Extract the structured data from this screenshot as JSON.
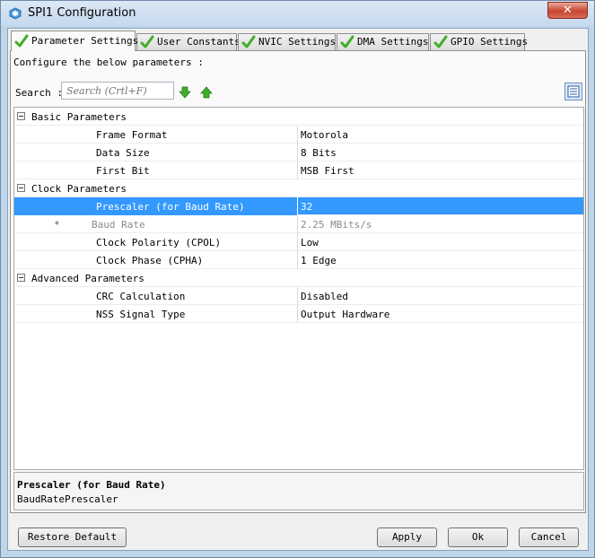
{
  "window": {
    "title": "SPI1 Configuration",
    "close_label": "✕",
    "icons": {
      "title": "gear-cube-icon",
      "close": "close-icon"
    }
  },
  "tabs": [
    {
      "label": "Parameter Settings",
      "active": true,
      "icon": "checkmark-icon"
    },
    {
      "label": "User Constants",
      "active": false,
      "icon": "checkmark-icon"
    },
    {
      "label": "NVIC Settings",
      "active": false,
      "icon": "checkmark-icon"
    },
    {
      "label": "DMA Settings",
      "active": false,
      "icon": "checkmark-icon"
    },
    {
      "label": "GPIO Settings",
      "active": false,
      "icon": "checkmark-icon"
    }
  ],
  "panel": {
    "instruction": "Configure the below parameters :",
    "search": {
      "label": "Search :",
      "placeholder": "Search (Crtl+F)",
      "down_icon": "arrow-down-icon",
      "up_icon": "arrow-up-icon"
    },
    "view_icon": "list-view-icon"
  },
  "groups": [
    {
      "label": "Basic Parameters",
      "params": [
        {
          "name": "Frame Format",
          "value": "Motorola"
        },
        {
          "name": "Data Size",
          "value": "8 Bits"
        },
        {
          "name": "First Bit",
          "value": "MSB First"
        }
      ]
    },
    {
      "label": "Clock Parameters",
      "params": [
        {
          "name": "Prescaler (for Baud Rate)",
          "value": "32",
          "selected": true
        },
        {
          "name": "Baud Rate",
          "value": "2.25 MBits/s",
          "disabled": true,
          "marker": "*"
        },
        {
          "name": "Clock Polarity (CPOL)",
          "value": "Low"
        },
        {
          "name": "Clock Phase (CPHA)",
          "value": "1 Edge"
        }
      ]
    },
    {
      "label": "Advanced Parameters",
      "params": [
        {
          "name": "CRC Calculation",
          "value": "Disabled"
        },
        {
          "name": "NSS Signal Type",
          "value": "Output Hardware"
        }
      ]
    }
  ],
  "description": {
    "title": "Prescaler (for Baud Rate)",
    "subtitle": "BaudRatePrescaler"
  },
  "buttons": {
    "restore": "Restore Default",
    "apply": "Apply",
    "ok": "Ok",
    "cancel": "Cancel"
  },
  "colors": {
    "selection": "#3399ff",
    "check_green": "#3fae2a",
    "close_red": "#c8462f"
  }
}
